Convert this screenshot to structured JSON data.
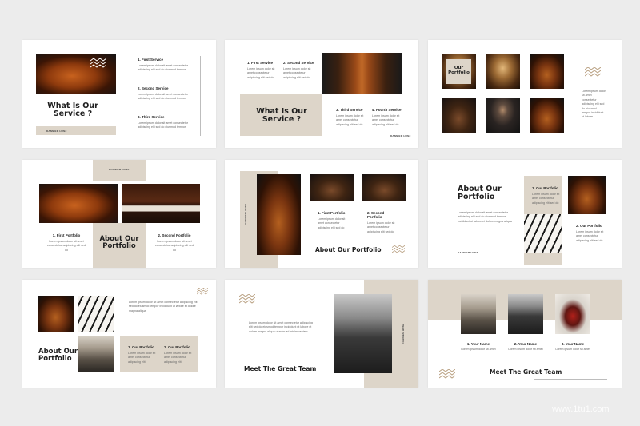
{
  "slide1": {
    "title": "What Is Our Service ?",
    "tag": "DANNIEM HUNZ",
    "items": [
      {
        "title": "1.  First Service",
        "text": "Lorem ipsum dolor sit amet consectetur adipiscing elit sed do eiusmod tempor"
      },
      {
        "title": "2.  Second Service",
        "text": "Lorem ipsum dolor sit amet consectetur adipiscing elit sed do eiusmod tempor"
      },
      {
        "title": "3.  Third Service",
        "text": "Lorem ipsum dolor sit amet consectetur adipiscing elit sed do eiusmod tempor"
      }
    ]
  },
  "slide2": {
    "title": "What Is Our Service ?",
    "tag": "DANNIEM HUNZ",
    "items": [
      {
        "title": "1.  First Service",
        "text": "Lorem ipsum dolor sit amet consectetur adipiscing elit sed do"
      },
      {
        "title": "2.  Second Service",
        "text": "Lorem ipsum dolor sit amet consectetur adipiscing elit sed do"
      },
      {
        "title": "3.  Third Service",
        "text": "Lorem ipsum dolor sit amet consectetur adipiscing elit sed do"
      },
      {
        "title": "4.  Fourth Service",
        "text": "Lorem ipsum dolor sit amet consectetur adipiscing elit sed do"
      }
    ]
  },
  "slide3": {
    "title": "Our Portfolio",
    "text": "Lorem ipsum dolor sit amet consectetur adipiscing elit sed do eiusmod tempor incididunt ut labore"
  },
  "slide4": {
    "title": "About Our Portfolio",
    "tag": "DANNIEM HUNZ",
    "items": [
      {
        "title": "1.  First Portfolio",
        "text": "Lorem ipsum dolor sit amet consectetur adipiscing elit sed do"
      },
      {
        "title": "2.  Second Portfolio",
        "text": "Lorem ipsum dolor sit amet consectetur adipiscing elit sed do"
      }
    ]
  },
  "slide5": {
    "title": "About Our Portfolio",
    "tag": "DANNIEM HUNZ",
    "items": [
      {
        "title": "1.  First Portfolio",
        "text": "Lorem ipsum dolor sit amet consectetur adipiscing elit sed do"
      },
      {
        "title": "2.  Second Portfolio",
        "text": "Lorem ipsum dolor sit amet consectetur adipiscing elit sed do"
      }
    ]
  },
  "slide6": {
    "title": "About Our Portfolio",
    "tag": "DANNIEM HUNZ",
    "text": "Lorem ipsum dolor sit amet consectetur adipiscing elit sed do eiusmod tempor incididunt ut labore et dolore magna aliqua",
    "items": [
      {
        "title": "1.  Our Portfolio",
        "text": "Lorem ipsum dolor sit amet consectetur adipiscing elit sed do"
      },
      {
        "title": "2.  Our Portfolio",
        "text": "Lorem ipsum dolor sit amet consectetur adipiscing elit sed do"
      }
    ]
  },
  "slide7": {
    "title": "About Our Portfolio",
    "text": "Lorem ipsum dolor sit amet consectetur adipiscing elit sed do eiusmod tempor incididunt ut labore et dolore magna aliqua",
    "items": [
      {
        "title": "1.  Our Portfolio",
        "text": "Lorem ipsum dolor sit amet consectetur adipiscing elit"
      },
      {
        "title": "2.  Our Portfolio",
        "text": "Lorem ipsum dolor sit amet consectetur adipiscing elit"
      }
    ]
  },
  "slide8": {
    "title": "Meet The Great Team",
    "tag": "DANNIEM HUNZ",
    "text": "Lorem ipsum dolor sit amet consectetur adipiscing elit sed do eiusmod tempor incididunt ut labore et dolore magna aliqua ut enim ad minim veniam"
  },
  "slide9": {
    "title": "Meet The Great Team",
    "members": [
      {
        "name": "1.  Your Name",
        "text": "Lorem ipsum dolor sit amet"
      },
      {
        "name": "2.  Your Name",
        "text": "Lorem ipsum dolor sit amet"
      },
      {
        "name": "3.  Your Name",
        "text": "Lorem ipsum dolor sit amet"
      }
    ]
  },
  "watermark": "www.1tu1.com",
  "colors": {
    "beige": "#ddd5c9",
    "background": "#ececec",
    "text": "#1f1f1f"
  }
}
